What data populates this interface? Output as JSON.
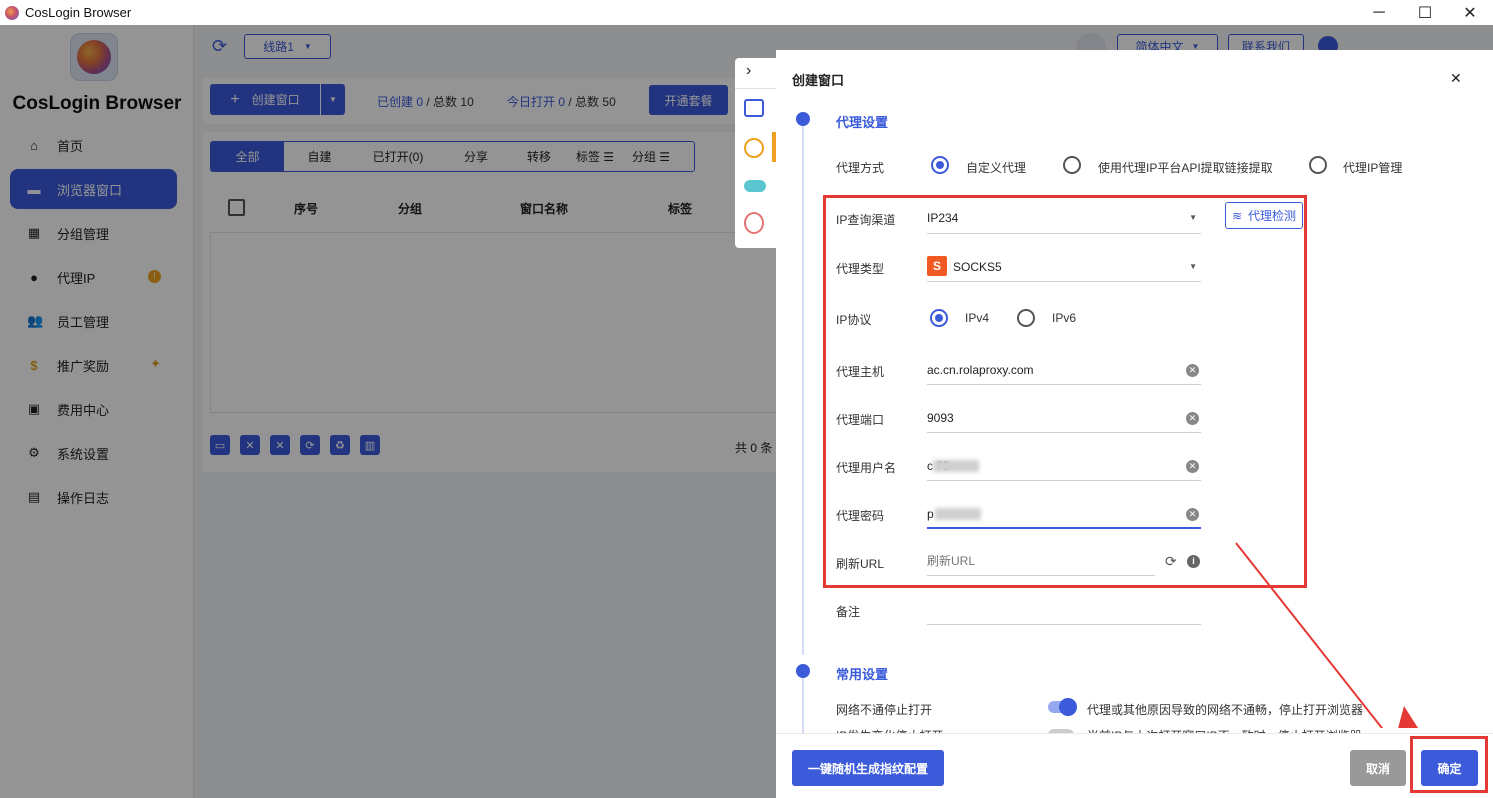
{
  "app": {
    "title": "CosLogin Browser",
    "brand": "CosLogin Browser"
  },
  "window_controls": {
    "minimize": "─",
    "maximize": "☐",
    "close": "✕"
  },
  "sidebar": {
    "items": [
      {
        "label": "首页",
        "icon": "home-icon",
        "glyph": "⌂"
      },
      {
        "label": "浏览器窗口",
        "icon": "browser-window-icon",
        "glyph": "▬"
      },
      {
        "label": "分组管理",
        "icon": "grid-icon",
        "glyph": "▦"
      },
      {
        "label": "代理IP",
        "icon": "location-pin-icon",
        "glyph": "●",
        "badge": "!"
      },
      {
        "label": "员工管理",
        "icon": "users-icon",
        "glyph": "👥"
      },
      {
        "label": "推广奖励",
        "icon": "dollar-icon",
        "glyph": "$",
        "spark": "✦"
      },
      {
        "label": "费用中心",
        "icon": "billing-icon",
        "glyph": "▣"
      },
      {
        "label": "系统设置",
        "icon": "gear-icon",
        "glyph": "⚙"
      },
      {
        "label": "操作日志",
        "icon": "document-icon",
        "glyph": "▤"
      }
    ]
  },
  "topbar": {
    "refresh_glyph": "⟳",
    "route": "线路1",
    "language": "简体中文",
    "contact": "联系我们"
  },
  "toolbar": {
    "create_label": "创建窗口",
    "created_label": "已创建",
    "created_count": "0",
    "created_total": "/ 总数 10",
    "opened_label": "今日打开",
    "opened_count": "0",
    "opened_total": "/ 总数 50",
    "plan_label": "开通套餐"
  },
  "filter_tabs": [
    "全部",
    "自建",
    "已打开(0)",
    "分享",
    "转移",
    "标签",
    "分组"
  ],
  "table": {
    "columns": [
      "序号",
      "分组",
      "窗口名称",
      "标签"
    ],
    "total": "共 0 条"
  },
  "dialog": {
    "title": "创建窗口",
    "close": "✕",
    "proxy_section": "代理设置",
    "proxy_mode_label": "代理方式",
    "proxy_modes": [
      "自定义代理",
      "使用代理IP平台API提取链接提取",
      "代理IP管理"
    ],
    "ip_channel_label": "IP查询渠道",
    "ip_channel_value": "IP234",
    "proxy_check_label": "代理检测",
    "proxy_type_label": "代理类型",
    "proxy_type_badge": "S",
    "proxy_type_value": "SOCKS5",
    "ip_protocol_label": "IP协议",
    "ip_protocols": [
      "IPv4",
      "IPv6"
    ],
    "host_label": "代理主机",
    "host_value": "ac.cn.rolaproxy.com",
    "port_label": "代理端口",
    "port_value": "9093",
    "username_label": "代理用户名",
    "username_value": "c 75",
    "password_label": "代理密码",
    "password_value": "p",
    "refresh_url_label": "刷新URL",
    "refresh_url_placeholder": "刷新URL",
    "note_label": "备注",
    "common_section": "常用设置",
    "net_stop_label": "网络不通停止打开",
    "net_stop_desc": "代理或其他原因导致的网络不通畅，停止打开浏览器",
    "ip_change_label": "IP发生变化停止打开",
    "ip_change_desc": "当前IP与上次打开窗口IP不一致时，停止打开浏览器",
    "random_fp_label": "一键随机生成指纹配置",
    "cancel_label": "取消",
    "confirm_label": "确定"
  },
  "colors": {
    "accent": "#3b5bdb",
    "highlight": "#e53935",
    "toggle": "#3b5bdb"
  }
}
